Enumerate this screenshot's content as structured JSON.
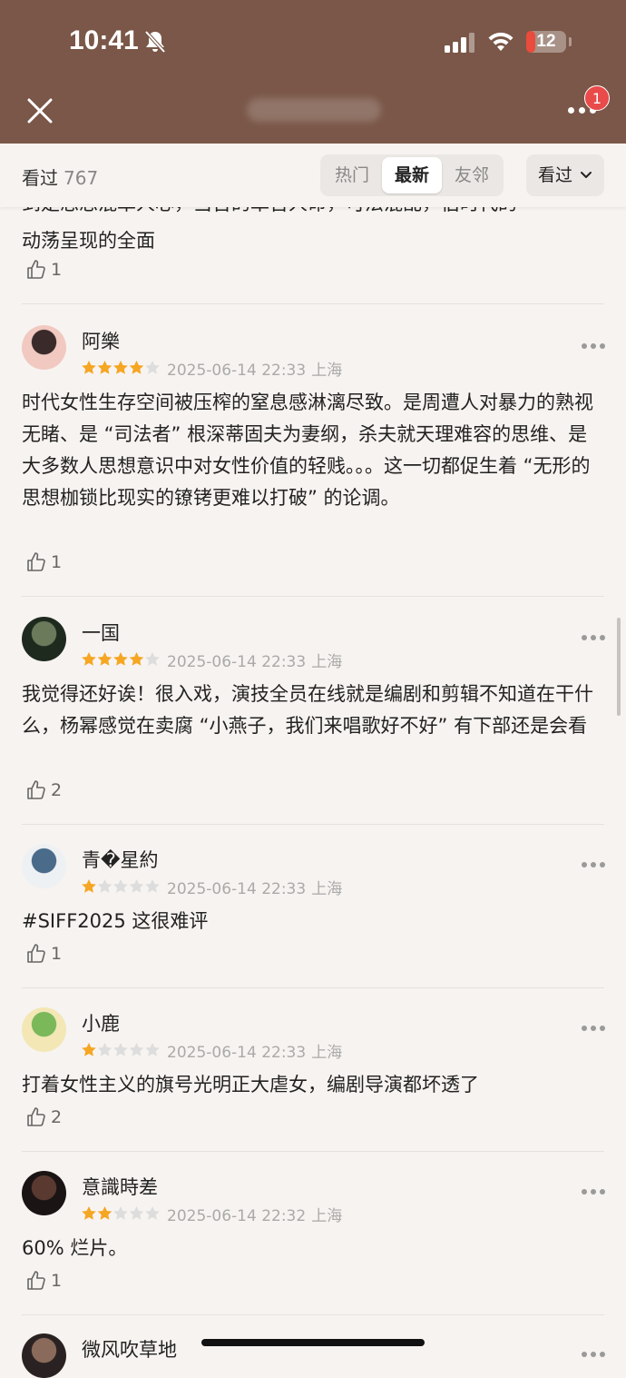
{
  "status_bar": {
    "time": "10:41",
    "battery": "12",
    "battery_level": 0.12
  },
  "header": {
    "badge_count": "1"
  },
  "filter": {
    "seen_label": "看过",
    "seen_count": "767",
    "tabs": [
      {
        "label": "热门",
        "active": false
      },
      {
        "label": "最新",
        "active": true
      },
      {
        "label": "友邻",
        "active": false
      }
    ],
    "dropdown_label": "看过"
  },
  "top_partial": {
    "text_line_cut": "到是思思混革人心，当告的革告人命，可法混乱，伯时代的",
    "text_line": "动荡呈现的全面",
    "likes": "1"
  },
  "reviews": [
    {
      "user": "阿樂",
      "rating": 4,
      "date": "2025-06-14 22:33",
      "location": "上海",
      "text": "时代女性生存空间被压榨的窒息感淋漓尽致。是周遭人对暴力的熟视无睹、是 “司法者” 根深蒂固夫为妻纲，杀夫就天理难容的思维、是大多数人思想意识中对女性价值的轻贱。。。这一切都促生着 “无形的思想枷锁比现实的镣铐更难以打破” 的论调。",
      "likes": "1",
      "avatar_colors": [
        "#f1c9c1",
        "#3a2a2a"
      ]
    },
    {
      "user": "一国",
      "rating": 4,
      "date": "2025-06-14 22:33",
      "location": "上海",
      "text": "我觉得还好诶！很入戏，演技全员在线就是编剧和剪辑不知道在干什么，杨幂感觉在卖腐 “小燕子，我们来唱歌好不好” 有下部还是会看",
      "likes": "2",
      "avatar_colors": [
        "#1f2a1f",
        "#6b7a5a"
      ]
    },
    {
      "user": "青�星約",
      "rating": 1,
      "date": "2025-06-14 22:33",
      "location": "上海",
      "text": "#SIFF2025 这很难评",
      "likes": "1",
      "avatar_colors": [
        "#eef1f4",
        "#4a6b8a"
      ]
    },
    {
      "user": "小鹿",
      "rating": 1,
      "date": "2025-06-14 22:33",
      "location": "上海",
      "text": "打着女性主义的旗号光明正大虐女，编剧导演都坏透了",
      "likes": "2",
      "avatar_colors": [
        "#f3e7b6",
        "#7bb85a"
      ]
    },
    {
      "user": "意識時差",
      "rating": 2,
      "date": "2025-06-14 22:32",
      "location": "上海",
      "text": "60% 烂片。",
      "likes": "1",
      "avatar_colors": [
        "#1a1414",
        "#5a3a30"
      ]
    },
    {
      "user": "微风吹草地",
      "rating": 0,
      "date": "",
      "location": "",
      "text": "",
      "likes": "",
      "avatar_colors": [
        "#2a2222",
        "#8a6a5a"
      ]
    }
  ],
  "colors": {
    "header_bg": "#7a5748",
    "page_bg": "#f7f3f0",
    "star_on": "#f5a623",
    "star_off": "#dddddd",
    "badge": "#e94a4a"
  }
}
